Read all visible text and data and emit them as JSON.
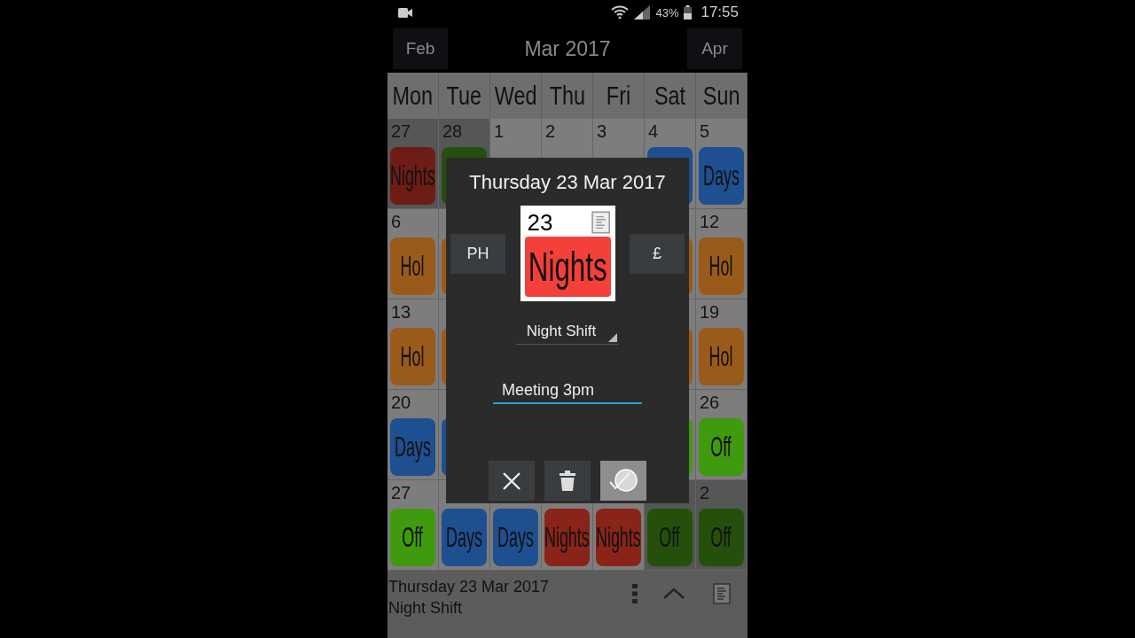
{
  "status_bar": {
    "battery": "43%",
    "time": "17:55"
  },
  "header": {
    "prev": "Feb",
    "title": "Mar 2017",
    "next": "Apr"
  },
  "weekdays": [
    "Mon",
    "Tue",
    "Wed",
    "Thu",
    "Fri",
    "Sat",
    "Sun"
  ],
  "weeks": [
    {
      "start": [
        {
          "day": "27",
          "outside_month": true,
          "shift": {
            "label": "Nights",
            "color": "#6e1c16"
          }
        },
        {
          "day": "28",
          "outside_month": true,
          "shift": {
            "color": "#24500c"
          }
        },
        {
          "day": "1",
          "outside_month": false
        },
        {
          "day": "2",
          "outside_month": false
        },
        {
          "day": "3",
          "outside_month": false
        },
        {
          "day": "4",
          "outside_month": false,
          "shift": {
            "color": "#1e4f90"
          }
        },
        {
          "day": "5",
          "outside_month": false,
          "shift": {
            "label": "Days",
            "color": "#1e4f90"
          }
        }
      ]
    },
    {
      "start": [
        {
          "day": "6",
          "outside_month": false,
          "shift": {
            "label": "Hol",
            "color": "#9a5a1a"
          }
        },
        {
          "outside_month": false,
          "shift": {
            "color": "#9a5a1a"
          }
        }
      ],
      "end": [
        {
          "outside_month": false,
          "shift": {
            "color": "#9a5a1a"
          }
        },
        {
          "day": "12",
          "outside_month": false,
          "shift": {
            "label": "Hol",
            "color": "#9a5a1a"
          }
        }
      ]
    },
    {
      "start": [
        {
          "day": "13",
          "outside_month": false,
          "shift": {
            "label": "Hol",
            "color": "#9a5a1a"
          }
        },
        {
          "outside_month": false,
          "shift": {
            "color": "#9a5a1a"
          }
        }
      ],
      "end": [
        {
          "outside_month": false,
          "shift": {
            "color": "#9a5a1a"
          }
        },
        {
          "day": "19",
          "outside_month": false,
          "shift": {
            "label": "Hol",
            "color": "#9a5a1a"
          }
        }
      ]
    },
    {
      "start": [
        {
          "day": "20",
          "outside_month": false,
          "shift": {
            "label": "Days",
            "color": "#1e4f90"
          }
        },
        {
          "outside_month": false,
          "shift": {
            "color": "#1e4f90"
          }
        }
      ],
      "end": [
        {
          "outside_month": false,
          "shift": {
            "color": "#3f9a0f"
          }
        },
        {
          "day": "26",
          "outside_month": false,
          "shift": {
            "label": "Off",
            "color": "#3f9a0f"
          }
        }
      ]
    },
    {
      "start": [
        {
          "day": "27",
          "outside_month": false,
          "shift": {
            "label": "Off",
            "color": "#3f9a0f"
          }
        },
        {
          "outside_month": false,
          "shift": {
            "label": "Days",
            "color": "#1e4f90"
          }
        },
        {
          "outside_month": false,
          "shift": {
            "label": "Days",
            "color": "#1e4f90"
          }
        },
        {
          "outside_month": false,
          "shift": {
            "label": "Nights",
            "color": "#8a2418"
          }
        },
        {
          "outside_month": false,
          "shift": {
            "label": "Nights",
            "color": "#8a2418"
          }
        },
        {
          "outside_month": true,
          "shift": {
            "label": "Off",
            "color": "#24500c"
          }
        },
        {
          "day": "2",
          "outside_month": true,
          "shift": {
            "label": "Off",
            "color": "#24500c"
          }
        }
      ]
    }
  ],
  "dialog": {
    "title": "Thursday 23 Mar 2017",
    "left_button": "PH",
    "right_button": "£",
    "day": "23",
    "shift": {
      "label": "Nights",
      "color": "#f4403a"
    },
    "shift_type": "Night Shift",
    "note": "Meeting 3pm",
    "actions": [
      {
        "kind": "cancel"
      },
      {
        "kind": "delete"
      },
      {
        "kind": "confirm"
      }
    ]
  },
  "footer": {
    "date": "Thursday 23 Mar 2017",
    "shift": "Night Shift"
  }
}
